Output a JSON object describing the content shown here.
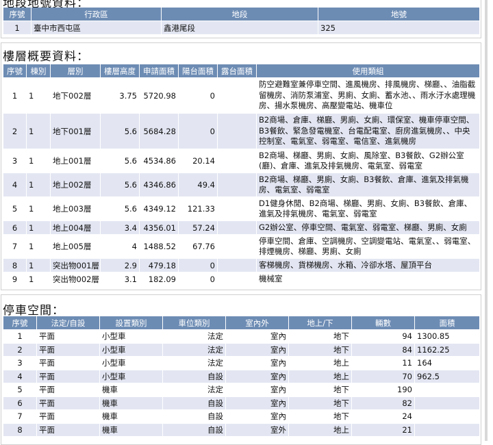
{
  "land": {
    "title": "地段地號資料：",
    "headers": [
      "序號",
      "行政區",
      "地段",
      "地號"
    ],
    "rows": [
      {
        "seq": "1",
        "district": "臺中市西屯區",
        "section": "鑫港尾段",
        "lot": "325"
      }
    ]
  },
  "floors": {
    "title": "樓層概要資料：",
    "headers": [
      "序號",
      "棟別",
      "層別",
      "樓層高度",
      "申請面積",
      "陽台面積",
      "露台面積",
      "使用類組"
    ],
    "rows": [
      {
        "seq": "1",
        "bldg": "1",
        "floor": "地下002層",
        "height": "3.75",
        "area": "5720.98",
        "balcony": "0",
        "terrace": "",
        "use": "防空避難室兼停車空間、進風機房、排風機房、梯廳、、油脂截留機房、消防泵浦室、男廁、女廁、蓄水池、、雨水汙水處理機房、揚水泵機房、高壓變電站、機車位"
      },
      {
        "seq": "2",
        "bldg": "1",
        "floor": "地下001層",
        "height": "5.6",
        "area": "5684.28",
        "balcony": "0",
        "terrace": "",
        "use": "B2商場、倉庫、梯廳、男廁、女廁、環保室、機車停車空間、B3餐飲、緊急發電機室、台電配電室、廚房進氣機房、、中央控制室、電氣室、弱電室、電信室、進氣機房"
      },
      {
        "seq": "3",
        "bldg": "1",
        "floor": "地上001層",
        "height": "5.6",
        "area": "4534.86",
        "balcony": "20.14",
        "terrace": "",
        "use": "B2商場、梯廳、男廁、女廁、風除室、B3餐飲、G2辦公室(廳)、倉庫、進氣及排氣機房、電氣室、弱電室"
      },
      {
        "seq": "4",
        "bldg": "1",
        "floor": "地上002層",
        "height": "5.6",
        "area": "4346.86",
        "balcony": "49.4",
        "terrace": "",
        "use": "B2商場、梯廳、男廁、女廁、B3餐飲、倉庫、進氣及排氣機房、電氣室、弱電室"
      },
      {
        "seq": "5",
        "bldg": "1",
        "floor": "地上003層",
        "height": "5.6",
        "area": "4349.12",
        "balcony": "121.33",
        "terrace": "",
        "use": "D1健身休閒、B2商場、梯廳、男廁、女廁、B3餐飲、倉庫、進氣及排氣機房、電氣室、弱電室"
      },
      {
        "seq": "6",
        "bldg": "1",
        "floor": "地上004層",
        "height": "3.4",
        "area": "4356.01",
        "balcony": "57.24",
        "terrace": "",
        "use": "G2辦公室、停車空間、電氣室、弱電室、梯廳、男廁、女廁"
      },
      {
        "seq": "7",
        "bldg": "1",
        "floor": "地上005層",
        "height": "4",
        "area": "1488.52",
        "balcony": "67.76",
        "terrace": "",
        "use": "停車空間、倉庫、空調機房、空調變電站、電氣室、、弱電室、排煙機房、梯廳、男廁、女廁"
      },
      {
        "seq": "8",
        "bldg": "1",
        "floor": "突出物001層",
        "height": "2.9",
        "area": "479.18",
        "balcony": "0",
        "terrace": "",
        "use": "客梯機房、貨梯機房、水箱、冷卻水塔、屋頂平台"
      },
      {
        "seq": "9",
        "bldg": "1",
        "floor": "突出物002層",
        "height": "3.1",
        "area": "182.09",
        "balcony": "0",
        "terrace": "",
        "use": "機械室"
      }
    ]
  },
  "parking": {
    "title": "停車空間：",
    "headers": [
      "序號",
      "法定/自設",
      "設置類別",
      "車位類別",
      "室內外",
      "地上/下",
      "輛數",
      "面積"
    ],
    "rows": [
      {
        "seq": "1",
        "legal": "平面",
        "type": "小型車",
        "cat": "法定",
        "io": "室內",
        "level": "地下",
        "count": "94",
        "area": "1300.85"
      },
      {
        "seq": "2",
        "legal": "平面",
        "type": "小型車",
        "cat": "法定",
        "io": "室內",
        "level": "地下",
        "count": "84",
        "area": "1162.25"
      },
      {
        "seq": "3",
        "legal": "平面",
        "type": "小型車",
        "cat": "法定",
        "io": "室內",
        "level": "地上",
        "count": "11",
        "area": "164"
      },
      {
        "seq": "4",
        "legal": "平面",
        "type": "小型車",
        "cat": "自設",
        "io": "室內",
        "level": "地上",
        "count": "70",
        "area": "962.5"
      },
      {
        "seq": "5",
        "legal": "平面",
        "type": "機車",
        "cat": "法定",
        "io": "室內",
        "level": "地下",
        "count": "190",
        "area": ""
      },
      {
        "seq": "6",
        "legal": "平面",
        "type": "機車",
        "cat": "自設",
        "io": "室內",
        "level": "地下",
        "count": "82",
        "area": ""
      },
      {
        "seq": "7",
        "legal": "平面",
        "type": "機車",
        "cat": "自設",
        "io": "室內",
        "level": "地下",
        "count": "24",
        "area": ""
      },
      {
        "seq": "8",
        "legal": "平面",
        "type": "機車",
        "cat": "自設",
        "io": "室外",
        "level": "地上",
        "count": "21",
        "area": ""
      }
    ]
  }
}
